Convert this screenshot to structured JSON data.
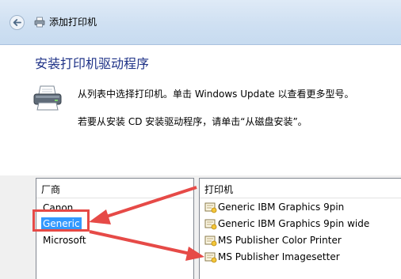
{
  "window": {
    "title": "添加打印机",
    "back_icon": "back-arrow-icon",
    "app_icon": "printer-icon"
  },
  "page": {
    "heading": "安装打印机驱动程序",
    "instruction_1": "从列表中选择打印机。单击 Windows Update 以查看更多型号。",
    "instruction_2": "若要从安装 CD 安装驱动程序，请单击“从磁盘安装”。",
    "printer_icon": "printer-icon"
  },
  "manufacturers": {
    "header": "厂商",
    "items": [
      {
        "label": "Canon",
        "selected": false
      },
      {
        "label": "Generic",
        "selected": true
      },
      {
        "label": "Microsoft",
        "selected": false
      }
    ]
  },
  "printers": {
    "header": "打印机",
    "item_icon": "certified-driver-icon",
    "items": [
      {
        "label": "Generic IBM Graphics 9pin"
      },
      {
        "label": "Generic IBM Graphics 9pin wide"
      },
      {
        "label": "MS Publisher Color Printer"
      },
      {
        "label": "MS Publisher Imagesetter"
      }
    ]
  },
  "colors": {
    "heading": "#1e3287",
    "selection": "#3399ff",
    "annotation": "#e64a47"
  }
}
